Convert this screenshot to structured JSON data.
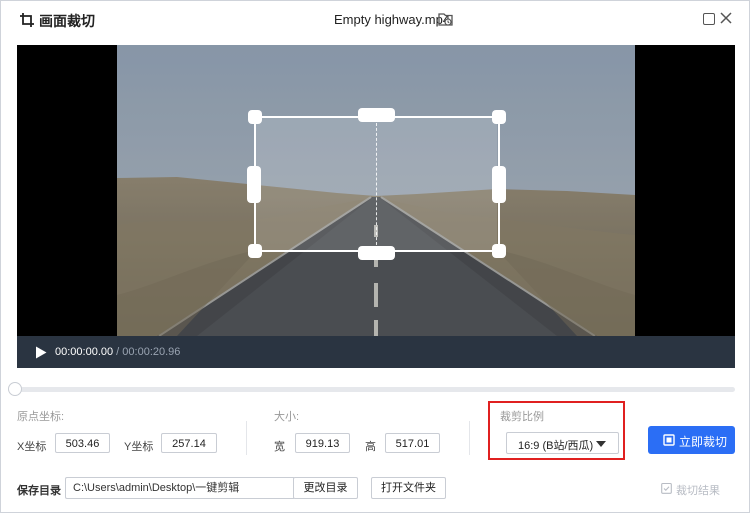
{
  "window": {
    "app_title": "画面裁切",
    "file_name": "Empty highway.mp4"
  },
  "player": {
    "current_time": "00:00:00.00",
    "separator": " / ",
    "duration": "00:00:20.96",
    "timeline_progress": 0.0
  },
  "origin": {
    "section_label": "原点坐标:",
    "x_label": "X坐标",
    "x_value": "503.46",
    "y_label": "Y坐标",
    "y_value": "257.14"
  },
  "size": {
    "section_label": "大小:",
    "width_label": "宽",
    "width_value": "919.13",
    "height_label": "高",
    "height_value": "517.01"
  },
  "ratio": {
    "section_label": "裁剪比例",
    "selected": "16:9 (B站/西瓜)"
  },
  "actions": {
    "crop_now": "立即裁切",
    "crop_result": "裁切结果"
  },
  "save": {
    "label": "保存目录",
    "path": "C:\\Users\\admin\\Desktop\\一键剪辑",
    "change_dir": "更改目录",
    "open_folder": "打开文件夹"
  },
  "colors": {
    "accent": "#2b6ef5",
    "highlight": "#e02020",
    "control_bar": "#2a3441"
  }
}
